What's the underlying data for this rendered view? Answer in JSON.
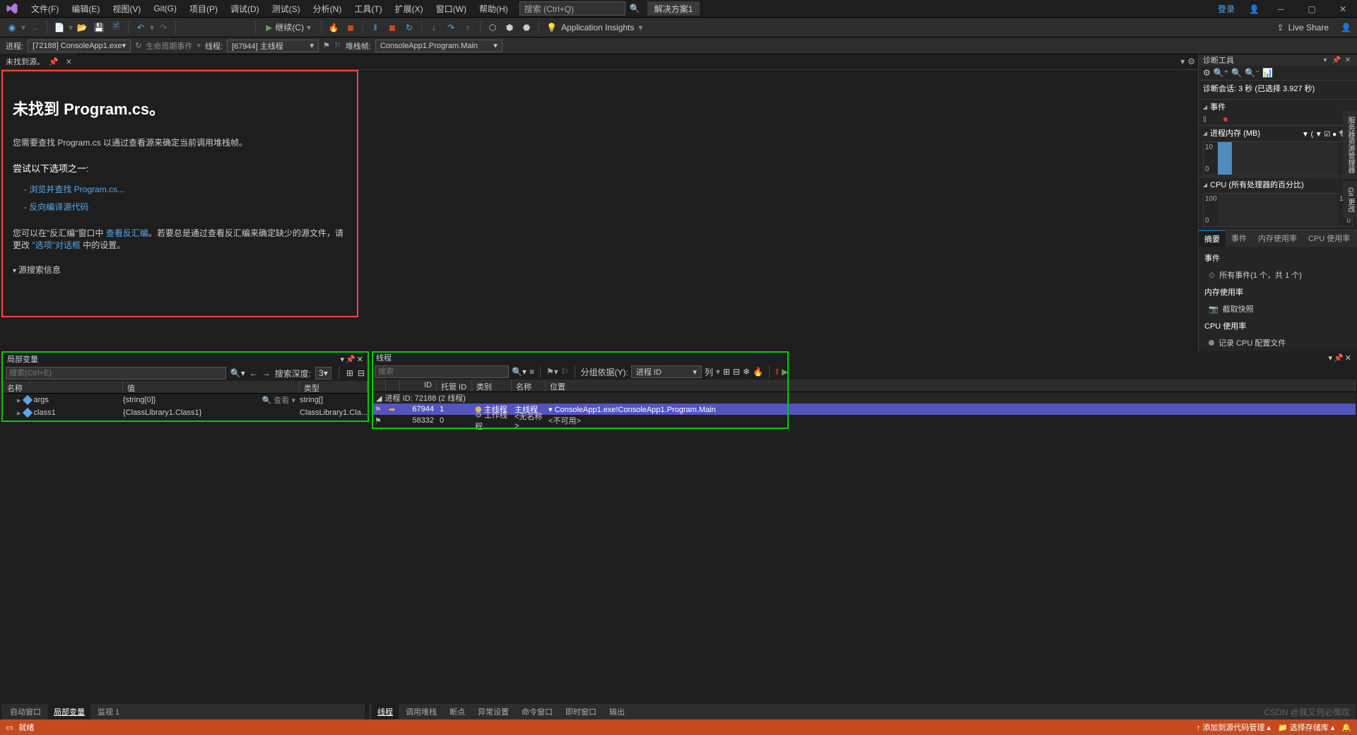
{
  "menubar": [
    "文件(F)",
    "编辑(E)",
    "视图(V)",
    "Git(G)",
    "项目(P)",
    "调试(D)",
    "测试(S)",
    "分析(N)",
    "工具(T)",
    "扩展(X)",
    "窗口(W)",
    "帮助(H)"
  ],
  "search_placeholder": "搜索 (Ctrl+Q)",
  "solution_label": "解决方案1",
  "login": "登录",
  "toolbar": {
    "continue": "继续(C)",
    "insights": "Application Insights",
    "live_share": "Live Share"
  },
  "debugbar": {
    "process_lbl": "进程:",
    "process_val": "[72188] ConsoleApp1.exe",
    "lifecycle": "生命周期事件",
    "thread_lbl": "线程:",
    "thread_val": "[67944] 主线程",
    "frame_lbl": "堆栈帧:",
    "frame_val": "ConsoleApp1.Program.Main"
  },
  "doc_tab": "未找到源。",
  "notfound": {
    "title": "未找到 Program.cs。",
    "line1": "您需要查找 Program.cs 以通过查看源来确定当前调用堆栈帧。",
    "sub": "尝试以下选项之一:",
    "opt1": "浏览并查找 Program.cs...",
    "opt2": "反向编译源代码",
    "line2a": "您可以在\"反汇编\"窗口中 ",
    "line2_link1": "查看反汇编",
    "line2b": "。若要总是通过查看反汇编来确定缺少的源文件，请更改 ",
    "line2_link2": "\"选项\"对话框",
    "line2c": " 中的设置。",
    "expand": "源搜索信息"
  },
  "diag": {
    "panel_title": "诊断工具",
    "session": "诊断会话: 3 秒 (已选择 3.927 秒)",
    "events": "事件",
    "mem_hdr": "进程内存 (MB)",
    "mem_flags": "▼ ( ▼ ☑ ● 专…",
    "mem_max": "10",
    "mem_min": "0",
    "cpu_hdr": "CPU (所有处理器的百分比)",
    "cpu_max": "100",
    "cpu_min": "0",
    "tabs": [
      "摘要",
      "事件",
      "内存使用率",
      "CPU 使用率"
    ],
    "body_events": "事件",
    "body_events_all": "所有事件(1 个，共 1 个)",
    "body_mem": "内存使用率",
    "body_mem_snap": "截取快照",
    "body_cpu": "CPU 使用率",
    "body_cpu_rec": "记录 CPU 配置文件"
  },
  "side_tabs": [
    "服务器资源管理器",
    "Git 更改"
  ],
  "locals": {
    "title": "局部变量",
    "search_ph": "搜索(Ctrl+E)",
    "depth_lbl": "搜索深度:",
    "depth_val": "3",
    "hdr": [
      "名称",
      "值",
      "类型"
    ],
    "rows": [
      {
        "name": "args",
        "value": "{string[0]}",
        "type": "string[]",
        "view": "查看"
      },
      {
        "name": "class1",
        "value": "{ClassLibrary1.Class1}",
        "type": "ClassLibrary1.Cla..."
      }
    ]
  },
  "threads": {
    "title": "线程",
    "search_ph": "搜索",
    "group_lbl": "分组依据(Y):",
    "group_val": "进程 ID",
    "cols_lbl": "列",
    "hdr": {
      "id": "ID",
      "managed": "托管 ID",
      "category": "类别",
      "name": "名称",
      "location": "位置"
    },
    "group_row": "进程 ID: 72188 (2 线程)",
    "rows": [
      {
        "flag": true,
        "arrow": true,
        "id": "67944",
        "managed": "1",
        "category": "主线程",
        "name": "主线程",
        "loc_icon": "▾",
        "location": "ConsoleApp1.exe!ConsoleApp1.Program.Main",
        "sel": true
      },
      {
        "flag": true,
        "arrow": false,
        "id": "58332",
        "managed": "0",
        "category": "工作线程",
        "name": "<无名称>",
        "location": "<不可用>",
        "sel": false
      }
    ]
  },
  "bottom_tabs_left": [
    "自动窗口",
    "局部变量",
    "监视 1"
  ],
  "bottom_tabs_right": [
    "线程",
    "调用堆栈",
    "断点",
    "异常设置",
    "命令窗口",
    "即时窗口",
    "输出"
  ],
  "status": {
    "ready": "就绪",
    "right1": "添加到源代码管理",
    "right2": "选择存储库"
  },
  "watermark": "CSDN @我又何必慨叹"
}
